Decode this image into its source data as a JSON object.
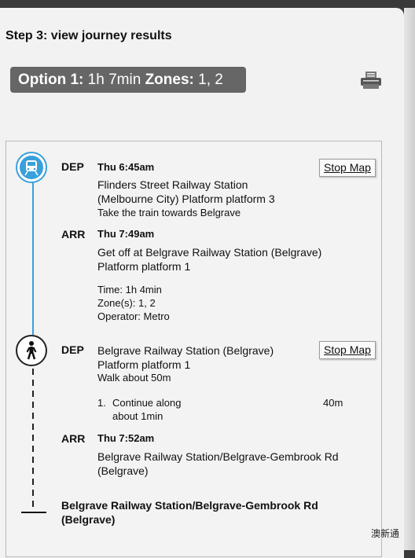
{
  "header": {
    "step_title": "Step 3: view journey results",
    "option_label": "Option 1:",
    "option_duration": "1h 7min",
    "zones_label": "Zones:",
    "zones_value": "1, 2"
  },
  "legs": [
    {
      "icon": "train-icon",
      "dep_label": "DEP",
      "dep_time": "Thu 6:45am",
      "dep_station_line1": "Flinders Street Railway Station",
      "dep_station_line2": "(Melbourne City) Platform platform 3",
      "instruction": "Take the train towards Belgrave",
      "stop_map_label": "Stop Map",
      "arr_label": "ARR",
      "arr_time": "Thu 7:49am",
      "arr_text_line1": "Get off at Belgrave Railway Station (Belgrave)",
      "arr_text_line2": "Platform platform 1",
      "time_info": "Time: 1h 4min",
      "zones_info": "Zone(s): 1, 2",
      "operator_info": "Operator: Metro"
    },
    {
      "icon": "walk-icon",
      "dep_label": "DEP",
      "dep_station_line1": "Belgrave Railway Station (Belgrave)",
      "dep_station_line2": "Platform platform 1",
      "instruction": "Walk about 50m",
      "stop_map_label": "Stop Map",
      "step_number": "1.",
      "step_text_line1": "Continue along",
      "step_text_line2": "about 1min",
      "step_distance": "40m",
      "arr_label": "ARR",
      "arr_time": "Thu 7:52am",
      "arr_text_line1": "Belgrave Railway Station/Belgrave-Gembrook Rd",
      "arr_text_line2": "(Belgrave)"
    }
  ],
  "destination": "Belgrave Railway Station/Belgrave-Gembrook Rd (Belgrave)",
  "watermark": "澳新通",
  "colors": {
    "accent": "#3aa0dc",
    "badge": "#666666"
  }
}
